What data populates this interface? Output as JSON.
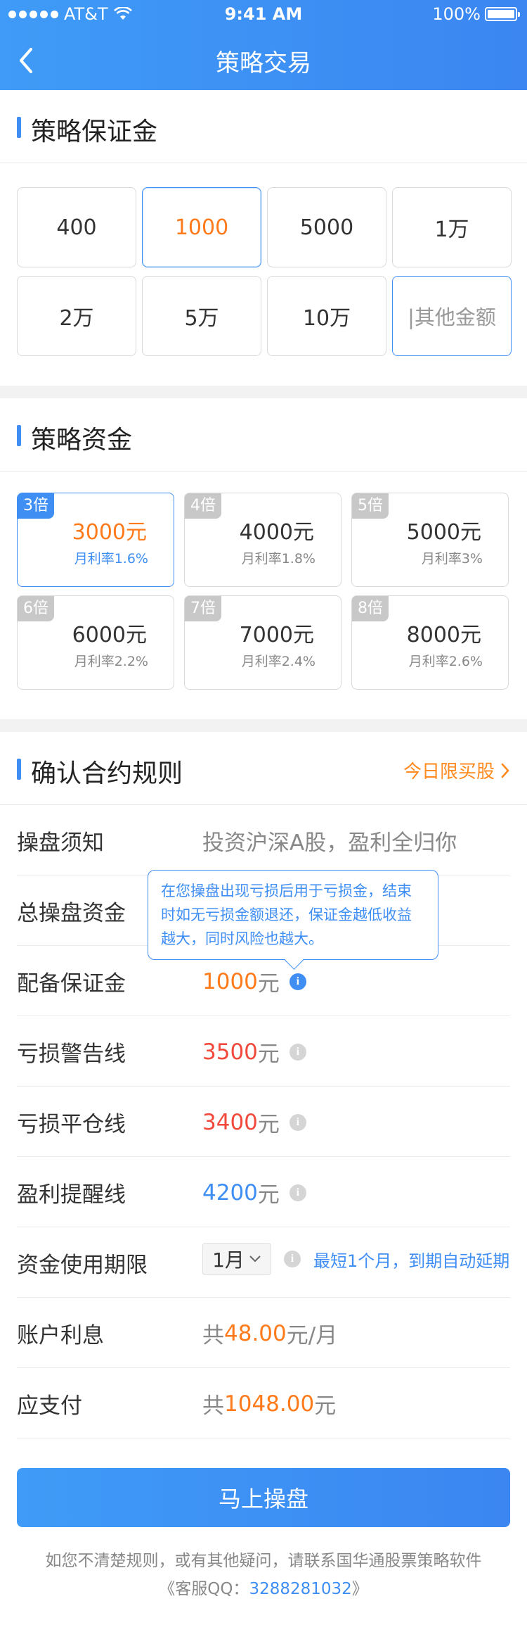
{
  "status": {
    "carrier": "AT&T",
    "time": "9:41 AM",
    "battery": "100%"
  },
  "header": {
    "title": "策略交易"
  },
  "margin": {
    "title": "策略保证金",
    "options": [
      "400",
      "1000",
      "5000",
      "1万",
      "2万",
      "5万",
      "10万"
    ],
    "selected": "1000",
    "custom_placeholder": "|其他金额"
  },
  "capital": {
    "title": "策略资金",
    "options": [
      {
        "tag": "3倍",
        "amount": "3000元",
        "rate": "月利率1.6%"
      },
      {
        "tag": "4倍",
        "amount": "4000元",
        "rate": "月利率1.8%"
      },
      {
        "tag": "5倍",
        "amount": "5000元",
        "rate": "月利率3%"
      },
      {
        "tag": "6倍",
        "amount": "6000元",
        "rate": "月利率2.2%"
      },
      {
        "tag": "7倍",
        "amount": "7000元",
        "rate": "月利率2.4%"
      },
      {
        "tag": "8倍",
        "amount": "8000元",
        "rate": "月利率2.6%"
      }
    ],
    "selected": "3倍"
  },
  "rules": {
    "title": "确认合约规则",
    "promo": "今日限买股",
    "notice_label": "操盘须知",
    "notice_value": "投资沪深A股，盈利全归你",
    "total_label": "总操盘资金",
    "margin_label": "配备保证金",
    "margin_value": "1000",
    "warning_label": "亏损警告线",
    "warning_value": "3500",
    "liquidation_label": "亏损平仓线",
    "liquidation_value": "3400",
    "profit_label": "盈利提醒线",
    "profit_value": "4200",
    "yuan": "元",
    "period_label": "资金使用期限",
    "period_value": "1月",
    "period_note": "最短1个月，到期自动延期",
    "interest_label": "账户利息",
    "interest_prefix": "共",
    "interest_value": "48.00",
    "interest_unit": "元/月",
    "pay_label": "应支付",
    "pay_prefix": "共",
    "pay_value": "1048.00",
    "tooltip": "在您操盘出现亏损后用于亏损金，结束时如无亏损金额退还，保证金越低收益越大，同时风险也越大。"
  },
  "cta": {
    "label": "马上操盘"
  },
  "footer": {
    "line1": "如您不清楚规则，或有其他疑问，请联系国华通股票策略软件",
    "qq_prefix": "《客服QQ：",
    "qq": "3288281032",
    "qq_suffix": "》"
  },
  "colors": {
    "primary": "#3f8ef4",
    "orange": "#ff7a1a",
    "red": "#f2493d"
  }
}
